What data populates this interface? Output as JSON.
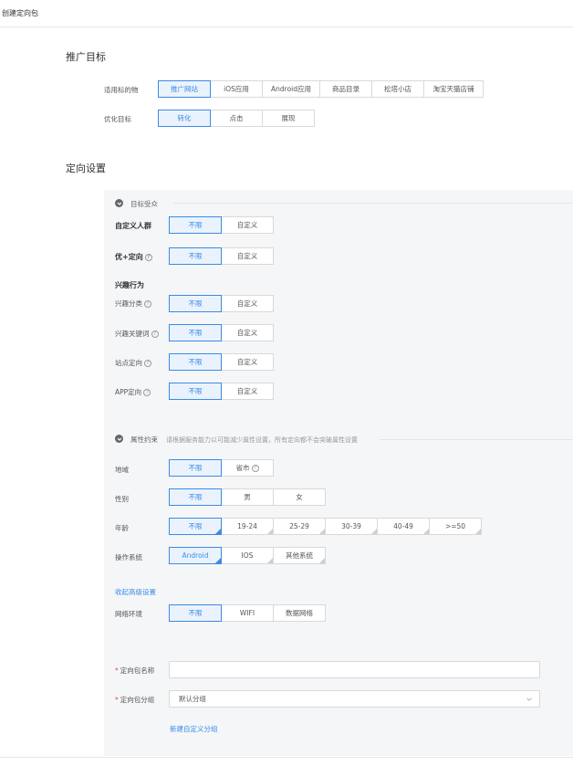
{
  "page": {
    "title": "创建定向包"
  },
  "promotion": {
    "section_title": "推广目标",
    "target_label": "适用标的物",
    "targets": [
      "推广网站",
      "iOS应用",
      "Android应用",
      "商品目录",
      "松塔小店",
      "淘宝天猫店铺"
    ],
    "goal_label": "优化目标",
    "goals": [
      "转化",
      "点击",
      "展现"
    ]
  },
  "targeting": {
    "section_title": "定向设置",
    "audience": {
      "title": "目标受众",
      "custom_crowd_label": "自定义人群",
      "youplus_label": "优+定向",
      "interest_behavior_label": "兴趣行为",
      "interest_category_label": "兴趣分类",
      "interest_keyword_label": "兴趣关键词",
      "site_label": "站点定向",
      "app_label": "APP定向",
      "opt_unlimited": "不限",
      "opt_custom": "自定义"
    },
    "attributes": {
      "title": "属性约束",
      "hint": "请根据服务能力以可能减少属性设置，所有定向都不会突破属性设置",
      "region_label": "地域",
      "region_options": [
        "不限",
        "省市"
      ],
      "gender_label": "性别",
      "gender_options": [
        "不限",
        "男",
        "女"
      ],
      "age_label": "年龄",
      "age_options": [
        "不限",
        "19-24",
        "25-29",
        "30-39",
        "40-49",
        ">=50"
      ],
      "os_label": "操作系统",
      "os_options": [
        "Android",
        "IOS",
        "其他系统"
      ],
      "advanced_link": "收起高级设置",
      "network_label": "网络环境",
      "network_options": [
        "不限",
        "WIFI",
        "数据网络"
      ]
    },
    "package": {
      "name_label": "定向包名称",
      "name_value": "",
      "group_label": "定向包分组",
      "group_value": "默认分组",
      "new_group_link": "新建自定义分组"
    }
  },
  "colors": {
    "accent": "#3b8ae6",
    "selected_bg": "#eaf3fd",
    "panel_bg": "#f5f6f8",
    "required": "#e05050"
  }
}
